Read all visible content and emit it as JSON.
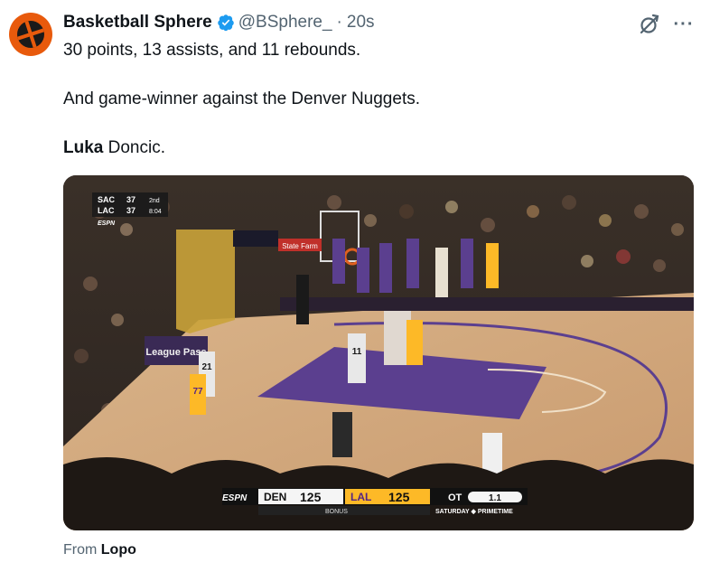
{
  "tweet": {
    "display_name": "Basketball Sphere",
    "handle": "@BSphere_",
    "separator": "·",
    "time": "20s",
    "line1": "30 points, 13 assists, and 11 rebounds.",
    "line2": "And game-winner against the Denver Nuggets.",
    "line3_bold": "Luka",
    "line3_rest": " Doncic.",
    "from_label": "From ",
    "from_source": "Lopo"
  },
  "scorebug_top": {
    "team1": "SAC",
    "score1": "37",
    "team2": "LAC",
    "score2": "37",
    "period": "2nd",
    "clock": "8:04",
    "network": "ESPN"
  },
  "scorebug_bottom": {
    "network": "ESPN",
    "home": "DEN",
    "home_score": "125",
    "away": "LAL",
    "away_score": "125",
    "period": "OT",
    "clock": "1.1",
    "bonus": "BONUS",
    "show": "SATURDAY ◆ PRIMETIME"
  },
  "arena_signs": {
    "league_pass": "League Pass",
    "state_farm": "State Farm",
    "jersey_21": "21",
    "jersey_77": "77",
    "jersey_11": "11"
  },
  "colors": {
    "brand_orange": "#e85a0c",
    "verified_blue": "#1d9bf0",
    "text_primary": "#0f1419",
    "text_secondary": "#536471",
    "lakers_purple": "#552583",
    "lakers_gold": "#fdb927"
  },
  "icons": {
    "avatar": "basketball-logo",
    "verified": "verified-badge-icon",
    "grok": "grok-icon",
    "more": "more-icon"
  }
}
